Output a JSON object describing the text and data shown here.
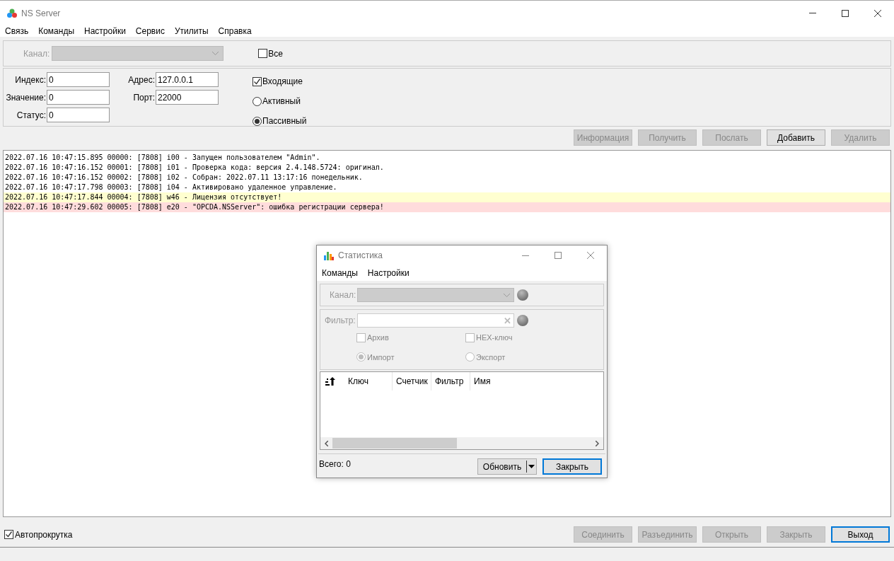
{
  "window": {
    "title": "NS Server"
  },
  "menu": [
    "Связь",
    "Команды",
    "Настройки",
    "Сервис",
    "Утилиты",
    "Справка"
  ],
  "channel": {
    "label": "Канал:",
    "disabled": true,
    "all": {
      "label": "Все",
      "checked": false
    }
  },
  "fields": [
    {
      "label": "Индекс:",
      "value": "0"
    },
    {
      "label": "Значение:",
      "value": "0"
    },
    {
      "label": "Статус:",
      "value": "0"
    }
  ],
  "connection": [
    {
      "label": "Адрес:",
      "value": "127.0.0.1"
    },
    {
      "label": "Порт:",
      "value": "22000"
    }
  ],
  "incoming": {
    "label": "Входящие",
    "checked": true
  },
  "modes": [
    {
      "label": "Активный",
      "selected": false
    },
    {
      "label": "Пассивный",
      "selected": true
    }
  ],
  "actions": [
    {
      "label": "Информация",
      "disabled": true
    },
    {
      "label": "Получить",
      "disabled": true
    },
    {
      "label": "Послать",
      "disabled": true
    },
    {
      "label": "Добавить",
      "disabled": false
    },
    {
      "label": "Удалить",
      "disabled": true
    }
  ],
  "log": [
    {
      "kind": "info",
      "text": "2022.07.16 10:47:15.895 00000: [7808] i00 - Запущен пользователем \"Admin\"."
    },
    {
      "kind": "info",
      "text": "2022.07.16 10:47:16.152 00001: [7808] i01 - Проверка кода: версия 2.4.148.5724: оригинал."
    },
    {
      "kind": "info",
      "text": "2022.07.16 10:47:16.152 00002: [7808] i02 - Собран: 2022.07.11 13:17:16 понедельник."
    },
    {
      "kind": "info",
      "text": "2022.07.16 10:47:17.798 00003: [7808] i04 - Активировано удаленное управление."
    },
    {
      "kind": "warning",
      "text": "2022.07.16 10:47:17.844 00004: [7808] w46 - Лицензия отсутствует!"
    },
    {
      "kind": "error",
      "text": "2022.07.16 10:47:29.602 00005: [7808] e20 - \"OPCDA.NSServer\": ошибка регистрации сервера!"
    }
  ],
  "autoscroll": {
    "label": "Автопрокрутка",
    "checked": true
  },
  "bottom_buttons": [
    {
      "label": "Соединить",
      "disabled": true,
      "default": false
    },
    {
      "label": "Разъединить",
      "disabled": true,
      "default": false
    },
    {
      "label": "Открыть",
      "disabled": true,
      "default": false
    },
    {
      "label": "Закрыть",
      "disabled": true,
      "default": false
    },
    {
      "label": "Выход",
      "disabled": false,
      "default": true
    }
  ],
  "dialog": {
    "title": "Статистика",
    "menu": [
      "Команды",
      "Настройки"
    ],
    "channel": {
      "label": "Канал:"
    },
    "filter": {
      "label": "Фильтр:",
      "clear": "✕"
    },
    "options": [
      {
        "kind": "checkbox",
        "label": "Архив",
        "checked": false
      },
      {
        "kind": "checkbox",
        "label": "HEX-ключ",
        "checked": false
      },
      {
        "kind": "radio",
        "label": "Импорт",
        "selected": true
      },
      {
        "kind": "radio",
        "label": "Экспорт",
        "selected": false
      }
    ],
    "columns": [
      "Ключ",
      "Счетчик",
      "Фильтр",
      "Имя"
    ],
    "total": "Всего: 0",
    "buttons": [
      {
        "label": "Обновить",
        "kind": "split",
        "default": false
      },
      {
        "label": "Закрыть",
        "kind": "plain",
        "default": true
      }
    ]
  }
}
